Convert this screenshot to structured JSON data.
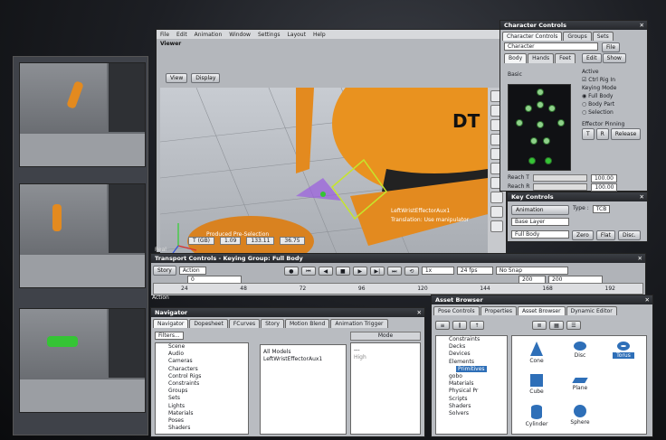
{
  "main_window": {
    "menu": [
      "File",
      "Edit",
      "Animation",
      "Window",
      "Settings",
      "Layout",
      "Help"
    ],
    "viewer_title": "Viewer",
    "view_button": "View",
    "display_button": "Display",
    "overlay_effector": "LeftWristEffectorAux1",
    "overlay_translation": "Translation: Use manipulator",
    "overlay_ground": "Produced Pre-Selection",
    "status": {
      "frame": "T (GB)",
      "v1": "1.09",
      "v2": "133.11",
      "v3": "36.75"
    },
    "model_label": "DT"
  },
  "character_controls": {
    "title": "Character Controls",
    "tabs": [
      "Character Controls",
      "Groups",
      "Sets"
    ],
    "character_label": "Character",
    "file_button": "File",
    "subtabs": [
      "Body",
      "Hands",
      "Feet"
    ],
    "edit_button": "Edit",
    "show_button": "Show",
    "basic_label": "Basic",
    "active_label": "Active",
    "ctrl_rig": "Ctrl Rig In",
    "keying_mode": "Keying Mode",
    "keying_options": [
      "Full Body",
      "Body Part",
      "Selection"
    ],
    "effector_pinning": "Effector Pinning",
    "pin_buttons": [
      "T",
      "R",
      "Release"
    ],
    "reach_t": "Reach T",
    "reach_r": "Reach R",
    "reach_value": "100.00",
    "reach_value2": "100.00"
  },
  "key_controls": {
    "title": "Key Controls",
    "animation": "Animation",
    "type_label": "Type :",
    "type_value": "TCB",
    "layer": "Base Layer",
    "fullbody": "Full Body",
    "buttons": [
      "Zero",
      "Flat",
      "Disc."
    ]
  },
  "transport": {
    "title": "Transport Controls  -  Keying Group: Full Body",
    "story": "Story",
    "action": "Action",
    "speed": "1x",
    "fps": "24 fps",
    "snap": "No Snap",
    "end_frame": "200",
    "end_frame2": "200",
    "start": "0",
    "ticks": [
      "24",
      "48",
      "72",
      "96",
      "120",
      "144",
      "168",
      "192"
    ],
    "action_label": "Action",
    "real": "Real"
  },
  "navigator": {
    "title": "Navigator",
    "tabs": [
      "Navigator",
      "Dopesheet",
      "FCurves",
      "Story",
      "Motion Blend",
      "Animation Trigger"
    ],
    "filters": "Filters...",
    "tree": [
      "Scene",
      "Audio",
      "Cameras",
      "Characters",
      "Control Rigs",
      "Constraints",
      "Groups",
      "Sets",
      "Lights",
      "Materials",
      "Poses",
      "Shaders"
    ],
    "models_header": "All Models",
    "model_item": "LeftWristEffectorAux1",
    "mode_header": "Mode",
    "mode_value": "---",
    "mode_value2": "High"
  },
  "asset_browser": {
    "title": "Asset Browser",
    "tabs": [
      "Pose Controls",
      "Properties",
      "Asset Browser",
      "Dynamic Editor"
    ],
    "tree": [
      "Constraints",
      "Decks",
      "Devices",
      "Elements",
      "Primitives",
      "gobo",
      "Materials",
      "Physical Pr",
      "Scripts",
      "Shaders",
      "Solvers"
    ],
    "items": [
      "Cone",
      "Disc",
      "Torus",
      "Cube",
      "Plane",
      "Cylinder",
      "Sphere"
    ]
  },
  "colors": {
    "accent": "#2e6fb8",
    "orange": "#e38a1f",
    "selection_green": "#35c435"
  }
}
